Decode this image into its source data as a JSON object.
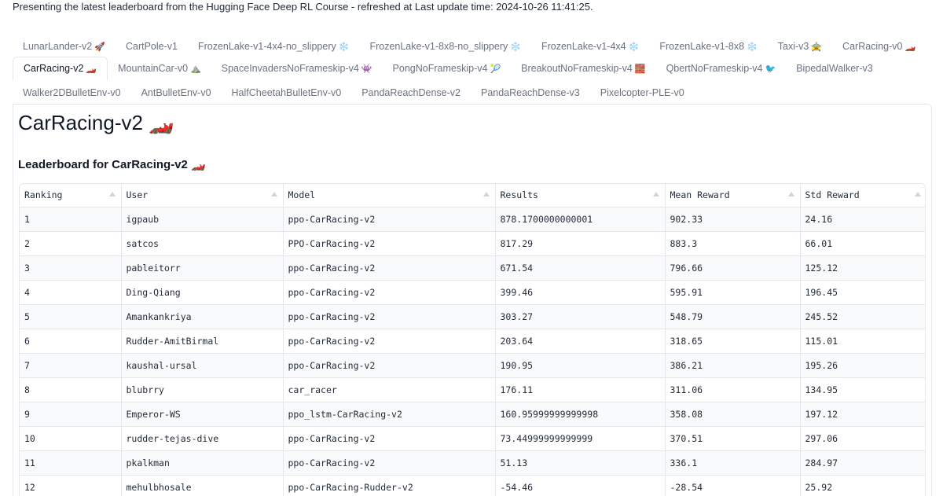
{
  "top_note": "Presenting the latest leaderboard from the Hugging Face Deep RL Course - refreshed at Last update time: 2024-10-26 11:41:25.",
  "tabs_row1": [
    {
      "label": "LunarLander-v2",
      "emoji": "🚀"
    },
    {
      "label": "CartPole-v1",
      "emoji": ""
    },
    {
      "label": "FrozenLake-v1-4x4-no_slippery",
      "emoji": "❄️"
    },
    {
      "label": "FrozenLake-v1-8x8-no_slippery",
      "emoji": "❄️"
    },
    {
      "label": "FrozenLake-v1-4x4",
      "emoji": "❄️"
    },
    {
      "label": "FrozenLake-v1-8x8",
      "emoji": "❄️"
    },
    {
      "label": "Taxi-v3",
      "emoji": "🚖"
    },
    {
      "label": "CarRacing-v0",
      "emoji": "🏎️"
    }
  ],
  "tabs_row2": [
    {
      "label": "CarRacing-v2",
      "emoji": "🏎️"
    },
    {
      "label": "MountainCar-v0",
      "emoji": "⛰️"
    },
    {
      "label": "SpaceInvadersNoFrameskip-v4",
      "emoji": "👾"
    },
    {
      "label": "PongNoFrameskip-v4",
      "emoji": "🎾"
    },
    {
      "label": "BreakoutNoFrameskip-v4",
      "emoji": "🧱"
    },
    {
      "label": "QbertNoFrameskip-v4",
      "emoji": "🐦"
    },
    {
      "label": "BipedalWalker-v3",
      "emoji": ""
    }
  ],
  "tabs_row3": [
    {
      "label": "Walker2DBulletEnv-v0",
      "emoji": ""
    },
    {
      "label": "AntBulletEnv-v0",
      "emoji": ""
    },
    {
      "label": "HalfCheetahBulletEnv-v0",
      "emoji": ""
    },
    {
      "label": "PandaReachDense-v2",
      "emoji": ""
    },
    {
      "label": "PandaReachDense-v3",
      "emoji": ""
    },
    {
      "label": "Pixelcopter-PLE-v0",
      "emoji": ""
    }
  ],
  "active_tab": "CarRacing-v2",
  "page_title": "CarRacing-v2 🏎️",
  "subtitle": "Leaderboard for CarRacing-v2 🏎️",
  "table": {
    "headers": [
      "Ranking",
      "User",
      "Model",
      "Results",
      "Mean Reward",
      "Std Reward"
    ],
    "rows": [
      [
        "1",
        "igpaub",
        "ppo-CarRacing-v2",
        "878.1700000000001",
        "902.33",
        "24.16"
      ],
      [
        "2",
        "satcos",
        "PPO-CarRacing-v2",
        "817.29",
        "883.3",
        "66.01"
      ],
      [
        "3",
        "pableitorr",
        "ppo-CarRacing-v2",
        "671.54",
        "796.66",
        "125.12"
      ],
      [
        "4",
        "Ding-Qiang",
        "ppo-CarRacing-v2",
        "399.46",
        "595.91",
        "196.45"
      ],
      [
        "5",
        "Amankankriya",
        "ppo-CarRacing-v2",
        "303.27",
        "548.79",
        "245.52"
      ],
      [
        "6",
        "Rudder-AmitBirmal",
        "ppo-CarRacing-v2",
        "203.64",
        "318.65",
        "115.01"
      ],
      [
        "7",
        "kaushal-ursal",
        "ppo-CarRacing-v2",
        "190.95",
        "386.21",
        "195.26"
      ],
      [
        "8",
        "blubrry",
        "car_racer",
        "176.11",
        "311.06",
        "134.95"
      ],
      [
        "9",
        "Emperor-WS",
        "ppo_lstm-CarRacing-v2",
        "160.95999999999998",
        "358.08",
        "197.12"
      ],
      [
        "10",
        "rudder-tejas-dive",
        "ppo-CarRacing-v2",
        "73.44999999999999",
        "370.51",
        "297.06"
      ],
      [
        "11",
        "pkalkman",
        "ppo-CarRacing-v2",
        "51.13",
        "336.1",
        "284.97"
      ],
      [
        "12",
        "mehulbhosale",
        "ppo-CarRacing-Rudder-v2",
        "-54.46",
        "-28.54",
        "25.92"
      ]
    ]
  }
}
